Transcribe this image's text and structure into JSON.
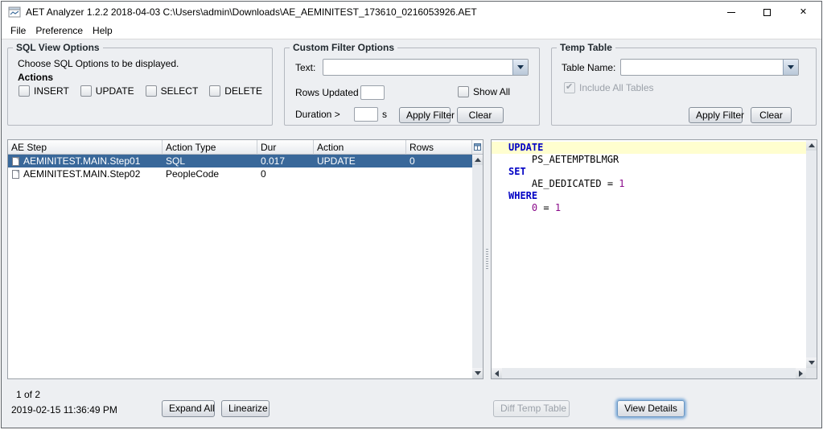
{
  "window": {
    "title": "AET Analyzer 1.2.2 2018-04-03  C:\\Users\\admin\\Downloads\\AE_AEMINITEST_173610_0216053926.AET",
    "controls": {
      "minimize": "–",
      "maximize": "□",
      "close": "✕"
    }
  },
  "menu": {
    "items": [
      "File",
      "Preference",
      "Help"
    ]
  },
  "sql_view_options": {
    "title": "SQL View Options",
    "description": "Choose SQL Options to be displayed.",
    "actions_label": "Actions",
    "checkboxes": [
      {
        "label": "INSERT",
        "checked": false
      },
      {
        "label": "UPDATE",
        "checked": false
      },
      {
        "label": "SELECT",
        "checked": false
      },
      {
        "label": "DELETE",
        "checked": false
      }
    ]
  },
  "custom_filter_options": {
    "title": "Custom Filter Options",
    "text_label": "Text:",
    "text_value": "",
    "rows_updated_label": "Rows Updated >",
    "rows_updated_value": "",
    "show_all_label": "Show All",
    "show_all_checked": false,
    "duration_label": "Duration >",
    "duration_value": "",
    "duration_unit": "s",
    "apply_filter_button": "Apply Filter",
    "clear_button": "Clear"
  },
  "temp_table": {
    "title": "Temp Table",
    "table_name_label": "Table Name:",
    "table_name_value": "",
    "include_all_tables_label": "Include All Tables",
    "include_all_tables_checked": true,
    "apply_filter_button": "Apply Filter",
    "clear_button": "Clear"
  },
  "steps_table": {
    "columns": [
      "AE Step",
      "Action Type",
      "Dur",
      "Action",
      "Rows"
    ],
    "rows": [
      {
        "ae_step": "AEMINITEST.MAIN.Step01",
        "action_type": "SQL",
        "dur": "0.017",
        "action": "UPDATE",
        "rows": "0",
        "selected": true
      },
      {
        "ae_step": "AEMINITEST.MAIN.Step02",
        "action_type": "PeopleCode",
        "dur": "0",
        "action": "",
        "rows": "",
        "selected": false
      }
    ]
  },
  "sql_viewer": {
    "lines": [
      {
        "highlight": true,
        "tokens": [
          {
            "text": "UPDATE",
            "type": "keyword"
          }
        ]
      },
      {
        "highlight": false,
        "tokens": [
          {
            "text": "    PS_AETEMPTBLMGR",
            "type": "plain"
          }
        ]
      },
      {
        "highlight": false,
        "tokens": [
          {
            "text": "SET",
            "type": "keyword"
          }
        ]
      },
      {
        "highlight": false,
        "tokens": [
          {
            "text": "    AE_DEDICATED ",
            "type": "plain"
          },
          {
            "text": "= ",
            "type": "plain"
          },
          {
            "text": "1",
            "type": "number"
          }
        ]
      },
      {
        "highlight": false,
        "tokens": [
          {
            "text": "WHERE",
            "type": "keyword"
          }
        ]
      },
      {
        "highlight": false,
        "tokens": [
          {
            "text": "    ",
            "type": "plain"
          },
          {
            "text": "0",
            "type": "number"
          },
          {
            "text": " = ",
            "type": "plain"
          },
          {
            "text": "1",
            "type": "number"
          }
        ]
      }
    ]
  },
  "status_bar": {
    "position": "1 of 2",
    "timestamp": "2019-02-15 11:36:49 PM"
  },
  "actions": {
    "expand_all_button": "Expand All",
    "linearize_button": "Linearize",
    "diff_temp_table_button": "Diff Temp Table",
    "view_details_button": "View Details"
  },
  "colors": {
    "selection": "#39689a",
    "keyword": "#0000c4",
    "number": "#8a0a8a",
    "highlight_line": "#fffecf"
  }
}
